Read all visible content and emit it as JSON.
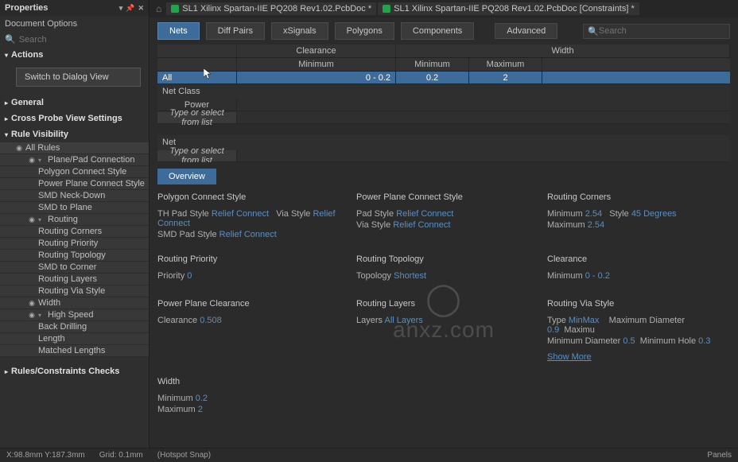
{
  "panel": {
    "title": "Properties",
    "doc_options": "Document Options",
    "search_placeholder": "Search",
    "sections": {
      "actions": "Actions",
      "general": "General",
      "cross_probe": "Cross Probe View Settings",
      "rule_vis": "Rule Visibility",
      "rules_checks": "Rules/Constraints Checks"
    },
    "switch_btn": "Switch to Dialog View",
    "tree": {
      "all_rules": "All Rules",
      "plane_pad": "Plane/Pad Connection",
      "poly_connect": "Polygon Connect Style",
      "power_plane_connect": "Power Plane Connect Style",
      "smd_neck": "SMD Neck-Down",
      "smd_plane": "SMD to Plane",
      "routing": "Routing",
      "routing_corners": "Routing Corners",
      "routing_priority": "Routing Priority",
      "routing_topology": "Routing Topology",
      "smd_corner": "SMD to Corner",
      "routing_layers": "Routing Layers",
      "routing_via": "Routing Via Style",
      "width": "Width",
      "high_speed": "High Speed",
      "back_drill": "Back Drilling",
      "length": "Length",
      "matched": "Matched Lengths"
    }
  },
  "tabs": {
    "t1": "SL1 Xilinx Spartan-IIE PQ208 Rev1.02.PcbDoc *",
    "t2": "SL1 Xilinx Spartan-IIE PQ208 Rev1.02.PcbDoc [Constraints] *"
  },
  "toolbar": {
    "nets": "Nets",
    "diff": "Diff Pairs",
    "xsig": "xSignals",
    "poly": "Polygons",
    "comp": "Components",
    "adv": "Advanced",
    "search_placeholder": "Search"
  },
  "grid": {
    "clearance": "Clearance",
    "width": "Width",
    "minimum": "Minimum",
    "maximum": "Maximum",
    "all": "All",
    "row_all_clear": "0 - 0.2",
    "row_all_min": "0.2",
    "row_all_max": "2",
    "net_class": "Net Class",
    "power": "Power",
    "type_select": "Type or select from list",
    "net": "Net"
  },
  "overview": {
    "tab": "Overview",
    "poly_connect": {
      "title": "Polygon Connect Style",
      "th_label": "TH Pad Style",
      "th_val": "Relief Connect",
      "via_label": "Via Style",
      "via_val": "Relief Connect",
      "smd_label": "SMD Pad Style",
      "smd_val": "Relief Connect"
    },
    "power_plane": {
      "title": "Power Plane Connect Style",
      "pad_label": "Pad Style",
      "pad_val": "Relief Connect",
      "via_label": "Via Style",
      "via_val": "Relief Connect"
    },
    "routing_corners": {
      "title": "Routing Corners",
      "min_label": "Minimum",
      "min_val": "2.54",
      "style_label": "Style",
      "style_val": "45 Degrees",
      "max_label": "Maximum",
      "max_val": "2.54"
    },
    "routing_priority": {
      "title": "Routing Priority",
      "prio_label": "Priority",
      "prio_val": "0"
    },
    "routing_topology": {
      "title": "Routing Topology",
      "topo_label": "Topology",
      "topo_val": "Shortest"
    },
    "clearance": {
      "title": "Clearance",
      "min_label": "Minimum",
      "min_val": "0 - 0.2"
    },
    "pp_clear": {
      "title": "Power Plane Clearance",
      "clear_label": "Clearance",
      "clear_val": "0.508"
    },
    "routing_layers": {
      "title": "Routing Layers",
      "layers_label": "Layers",
      "layers_val": "All Layers"
    },
    "routing_via": {
      "title": "Routing Via Style",
      "type_label": "Type",
      "type_val": "MinMax",
      "maxd_label": "Maximum Diameter",
      "maxd_val": "0.9",
      "maxu": "Maximu",
      "mind_label": "Minimum Diameter",
      "mind_val": "0.5",
      "minh_label": "Minimum Hole",
      "minh_val": "0.3",
      "show_more": "Show More"
    },
    "width": {
      "title": "Width",
      "min_label": "Minimum",
      "min_val": "0.2",
      "max_label": "Maximum",
      "max_val": "2"
    }
  },
  "status": {
    "coords": "X:98.8mm Y:187.3mm",
    "grid": "Grid: 0.1mm",
    "snap": "(Hotspot Snap)",
    "panels": "Panels"
  },
  "watermark": "anxz.com"
}
